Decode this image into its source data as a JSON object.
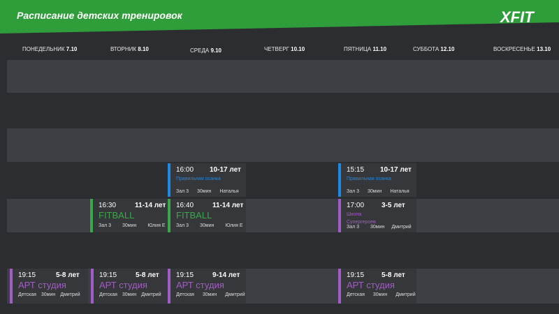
{
  "header": {
    "title": "Расписание детских тренировок",
    "logo": "XFIT",
    "brand_color": "#2f9e3a"
  },
  "days": [
    {
      "name": "ПОНЕДЕЛЬНИК",
      "date": "7.10"
    },
    {
      "name": "ВТОРНИК",
      "date": "8.10"
    },
    {
      "name": "СРЕДА",
      "date": "9.10"
    },
    {
      "name": "ЧЕТВЕРГ",
      "date": "10.10"
    },
    {
      "name": "ПЯТНИЦА",
      "date": "11.10"
    },
    {
      "name": "СУББОТА",
      "date": "12.10"
    },
    {
      "name": "ВОСКРЕСЕНЬЕ",
      "date": "13.10"
    }
  ],
  "sessions": [
    {
      "time": "16:00",
      "age": "10-17 лет",
      "name": "Правильная осанка",
      "room": "Зал 3",
      "duration": "30мин",
      "coach": "Наталья",
      "color": "#1e88e5"
    },
    {
      "time": "15:15",
      "age": "10-17 лет",
      "name": "Правильная осанка",
      "room": "Зал 3",
      "duration": "30мин",
      "coach": "Наталья",
      "color": "#1e88e5"
    },
    {
      "time": "16:30",
      "age": "11-14 лет",
      "name": "FITBALL",
      "room": "Зал 3",
      "duration": "30мин",
      "coach": "Юлия Е",
      "color": "#3aa84a"
    },
    {
      "time": "16:40",
      "age": "11-14 лет",
      "name": "FITBALL",
      "room": "Зал 3",
      "duration": "30мин",
      "coach": "Юлия Е",
      "color": "#3aa84a"
    },
    {
      "time": "17:00",
      "age": "3-5 лет",
      "name": "Школа Супергероев",
      "room": "Зал 3",
      "duration": "30мин",
      "coach": "Дмитрий",
      "color": "#a35bc7"
    },
    {
      "time": "19:15",
      "age": "5-8 лет",
      "name": "АРТ студия",
      "room": "Детская",
      "duration": "30мин",
      "coach": "Дмитрий",
      "color": "#a35bc7"
    },
    {
      "time": "19:15",
      "age": "5-8 лет",
      "name": "АРТ студия",
      "room": "Детская",
      "duration": "30мин",
      "coach": "Дмитрий",
      "color": "#a35bc7"
    },
    {
      "time": "19:15",
      "age": "9-14 лет",
      "name": "АРТ студия",
      "room": "Детская",
      "duration": "30мин",
      "coach": "Дмитрий",
      "color": "#a35bc7"
    },
    {
      "time": "19:15",
      "age": "5-8 лет",
      "name": "АРТ студия",
      "room": "Детская",
      "duration": "30мин",
      "coach": "Дмитрий",
      "color": "#a35bc7"
    }
  ]
}
